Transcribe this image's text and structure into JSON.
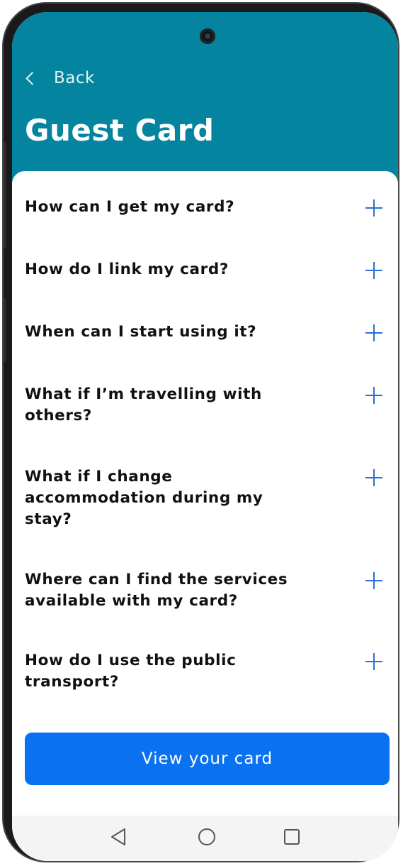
{
  "header": {
    "back_label": "Back",
    "title": "Guest Card",
    "background_color": "#05849f"
  },
  "faq": {
    "expand_icon": "plus-icon",
    "items": [
      {
        "question": "How can I get my card?"
      },
      {
        "question": "How do I link my card?"
      },
      {
        "question": "When can I start using it?"
      },
      {
        "question": "What if I’m travelling with others?"
      },
      {
        "question": "What if I change accommodation during my stay?"
      },
      {
        "question": "Where can I find the services available with my card?"
      },
      {
        "question": "How do I use the public transport?"
      }
    ]
  },
  "cta": {
    "label": "View your card",
    "color": "#0a72f0"
  },
  "system_nav": {
    "icons": [
      "back-triangle-icon",
      "home-circle-icon",
      "recents-square-icon"
    ]
  }
}
